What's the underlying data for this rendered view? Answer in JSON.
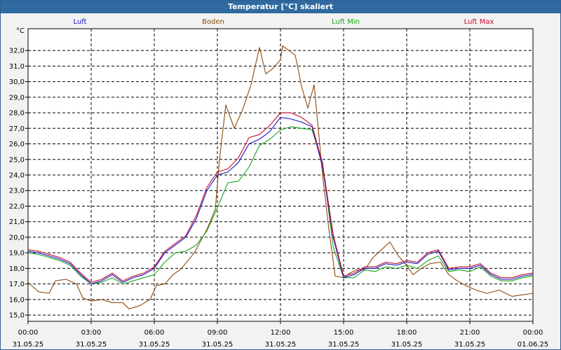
{
  "window": {
    "title": "Temperatur [°C] skaliert"
  },
  "chart_data": {
    "type": "line",
    "title": "Temperatur [°C] skaliert",
    "ylabel": "°C",
    "ylim": [
      14.6,
      33.4
    ],
    "xlim": [
      0,
      24
    ],
    "grid": true,
    "legend_position": "top",
    "y_ticks": [
      "15,0",
      "16,0",
      "17,0",
      "18,0",
      "19,0",
      "20,0",
      "21,0",
      "22,0",
      "23,0",
      "24,0",
      "25,0",
      "26,0",
      "27,0",
      "28,0",
      "29,0",
      "30,0",
      "31,0",
      "32,0"
    ],
    "y_tick_values": [
      15,
      16,
      17,
      18,
      19,
      20,
      21,
      22,
      23,
      24,
      25,
      26,
      27,
      28,
      29,
      30,
      31,
      32
    ],
    "x_ticks": [
      {
        "t": 0,
        "time": "00:00",
        "date": "31.05.25"
      },
      {
        "t": 3,
        "time": "03:00",
        "date": "31.05.25"
      },
      {
        "t": 6,
        "time": "06:00",
        "date": "31.05.25"
      },
      {
        "t": 9,
        "time": "09:00",
        "date": "31.05.25"
      },
      {
        "t": 12,
        "time": "12:00",
        "date": "31.05.25"
      },
      {
        "t": 15,
        "time": "15:00",
        "date": "31.05.25"
      },
      {
        "t": 18,
        "time": "18:00",
        "date": "31.05.25"
      },
      {
        "t": 21,
        "time": "21:00",
        "date": "31.05.25"
      },
      {
        "t": 24,
        "time": "00:00",
        "date": "01.06.25"
      }
    ],
    "series": [
      {
        "name": "Boden",
        "color": "#8b4a10",
        "x": [
          0,
          0.5,
          1,
          1.3,
          1.8,
          2.3,
          2.6,
          3,
          3.5,
          4,
          4.5,
          4.8,
          5.3,
          5.8,
          6.1,
          6.5,
          6.9,
          7.3,
          7.9,
          8.5,
          8.9,
          9.1,
          9.4,
          9.8,
          10.2,
          10.6,
          11,
          11.3,
          11.6,
          12,
          12.1,
          12.4,
          12.7,
          13,
          13.3,
          13.6,
          14,
          14.3,
          14.6,
          15,
          15.3,
          15.6,
          16,
          16.4,
          16.8,
          17.2,
          17.6,
          18,
          18.3,
          18.7,
          19.1,
          19.6,
          20,
          20.4,
          20.8,
          21.3,
          21.8,
          22.4,
          23,
          23.5,
          24
        ],
        "y": [
          17.1,
          16.5,
          16.4,
          17.2,
          17.3,
          17.0,
          16.1,
          15.9,
          16.0,
          15.8,
          15.8,
          15.4,
          15.6,
          16.0,
          16.9,
          17.0,
          17.6,
          18.0,
          19.0,
          20.5,
          21.8,
          25.0,
          28.5,
          27.0,
          28.2,
          29.8,
          32.2,
          30.5,
          30.8,
          31.4,
          32.3,
          32.0,
          31.7,
          29.7,
          28.3,
          29.8,
          24.0,
          20.5,
          17.5,
          17.4,
          17.7,
          17.9,
          17.9,
          18.7,
          19.2,
          19.7,
          18.8,
          18.2,
          17.6,
          18.0,
          18.3,
          18.4,
          17.6,
          17.2,
          16.9,
          16.6,
          16.4,
          16.6,
          16.2,
          16.3,
          16.4
        ]
      },
      {
        "name": "Luft Min",
        "color": "#1aa51a",
        "x": [
          0,
          0.5,
          1,
          1.5,
          2,
          2.5,
          3,
          3.5,
          4,
          4.5,
          5,
          5.5,
          6,
          6.5,
          7,
          7.5,
          8,
          8.5,
          9,
          9.5,
          10,
          10.5,
          11,
          11.5,
          12,
          12.5,
          13,
          13.5,
          14,
          14.5,
          15,
          15.5,
          16,
          16.5,
          17,
          17.5,
          18,
          18.5,
          19,
          19.5,
          20,
          20.5,
          21,
          21.5,
          22,
          22.5,
          23,
          23.5,
          24
        ],
        "y": [
          19.0,
          18.9,
          18.7,
          18.5,
          18.2,
          17.5,
          17.0,
          17.1,
          17.4,
          17.0,
          17.2,
          17.4,
          17.6,
          18.4,
          19.0,
          19.1,
          19.5,
          20.4,
          21.9,
          23.5,
          23.6,
          24.5,
          25.9,
          26.3,
          26.9,
          27.1,
          27.0,
          26.9,
          24.8,
          19.4,
          17.4,
          17.4,
          17.9,
          17.8,
          18.1,
          18.0,
          18.2,
          18.0,
          18.5,
          18.8,
          17.8,
          17.9,
          17.8,
          18.1,
          17.5,
          17.2,
          17.2,
          17.4,
          17.5
        ]
      },
      {
        "name": "Luft",
        "color": "#1515c8",
        "x": [
          0,
          0.5,
          1,
          1.5,
          2,
          2.5,
          3,
          3.5,
          4,
          4.5,
          5,
          5.5,
          6,
          6.5,
          7,
          7.5,
          8,
          8.5,
          9,
          9.5,
          10,
          10.5,
          11,
          11.5,
          12,
          12.5,
          13,
          13.5,
          14,
          14.5,
          15,
          15.5,
          16,
          16.5,
          17,
          17.5,
          18,
          18.5,
          19,
          19.5,
          20,
          20.5,
          21,
          21.5,
          22,
          22.5,
          23,
          23.5,
          24
        ],
        "y": [
          19.1,
          19.0,
          18.8,
          18.6,
          18.3,
          17.6,
          17.0,
          17.2,
          17.6,
          17.1,
          17.4,
          17.6,
          18.0,
          19.0,
          19.5,
          20.0,
          21.2,
          23.0,
          24.0,
          24.2,
          24.8,
          26.0,
          26.3,
          26.8,
          27.7,
          27.6,
          27.4,
          27.1,
          24.5,
          20.0,
          17.4,
          17.6,
          18.0,
          18.0,
          18.3,
          18.2,
          18.4,
          18.3,
          18.9,
          19.1,
          17.9,
          18.0,
          18.0,
          18.2,
          17.6,
          17.3,
          17.3,
          17.5,
          17.6
        ]
      },
      {
        "name": "Luft Max",
        "color": "#c80a2a",
        "x": [
          0,
          0.5,
          1,
          1.5,
          2,
          2.5,
          3,
          3.5,
          4,
          4.5,
          5,
          5.5,
          6,
          6.5,
          7,
          7.5,
          8,
          8.5,
          9,
          9.5,
          10,
          10.5,
          11,
          11.5,
          12,
          12.5,
          13,
          13.5,
          14,
          14.5,
          15,
          15.5,
          16,
          16.5,
          17,
          17.5,
          18,
          18.5,
          19,
          19.5,
          20,
          20.5,
          21,
          21.5,
          22,
          22.5,
          23,
          23.5,
          24
        ],
        "y": [
          19.2,
          19.1,
          18.9,
          18.7,
          18.4,
          17.7,
          17.1,
          17.3,
          17.7,
          17.2,
          17.5,
          17.7,
          18.1,
          19.1,
          19.6,
          20.1,
          21.4,
          23.2,
          24.2,
          24.4,
          25.1,
          26.4,
          26.6,
          27.2,
          28.0,
          28.0,
          27.7,
          27.2,
          24.7,
          20.2,
          17.5,
          17.7,
          18.1,
          18.1,
          18.4,
          18.3,
          18.5,
          18.4,
          19.0,
          19.2,
          18.0,
          18.1,
          18.1,
          18.3,
          17.7,
          17.4,
          17.4,
          17.6,
          17.7
        ]
      }
    ]
  }
}
